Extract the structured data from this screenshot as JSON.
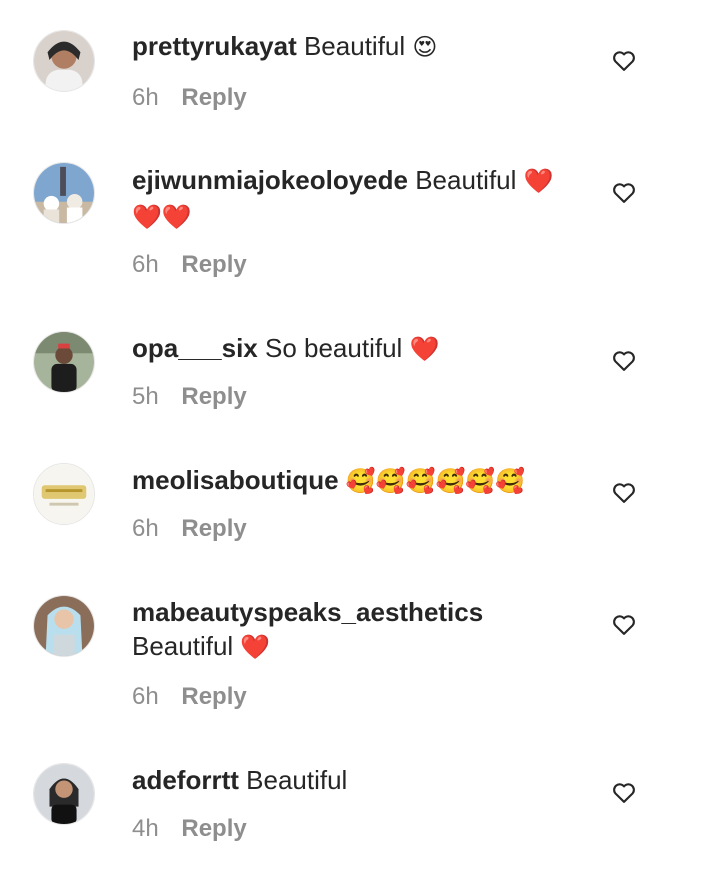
{
  "reply_label": "Reply",
  "colors": {
    "text": "#262626",
    "meta": "#8e8e8e",
    "heart": "#e0202a",
    "background": "#ffffff"
  },
  "icons": {
    "like": "heart-outline-icon"
  },
  "comments": [
    {
      "username": "prettyrukayat",
      "text": "Beautiful",
      "emoji": "😍",
      "extra": "",
      "time": "6h"
    },
    {
      "username": "ejiwunmiajokeoloyede",
      "text": "Beautiful",
      "emoji": "❤️",
      "extra": "❤️❤️",
      "time": "6h"
    },
    {
      "username": "opa___six",
      "text": "So beautiful",
      "emoji": "❤️",
      "extra": "",
      "time": "5h"
    },
    {
      "username": "meolisaboutique",
      "text": "",
      "emoji": "🥰🥰🥰🥰🥰🥰",
      "extra": "",
      "time": "6h"
    },
    {
      "username": "mabeautyspeaks_aesthetics",
      "text": "Beautiful",
      "emoji": "❤️",
      "extra": "",
      "time": "6h"
    },
    {
      "username": "adeforrtt",
      "text": "Beautiful",
      "emoji": "",
      "extra": "",
      "time": "4h"
    }
  ]
}
